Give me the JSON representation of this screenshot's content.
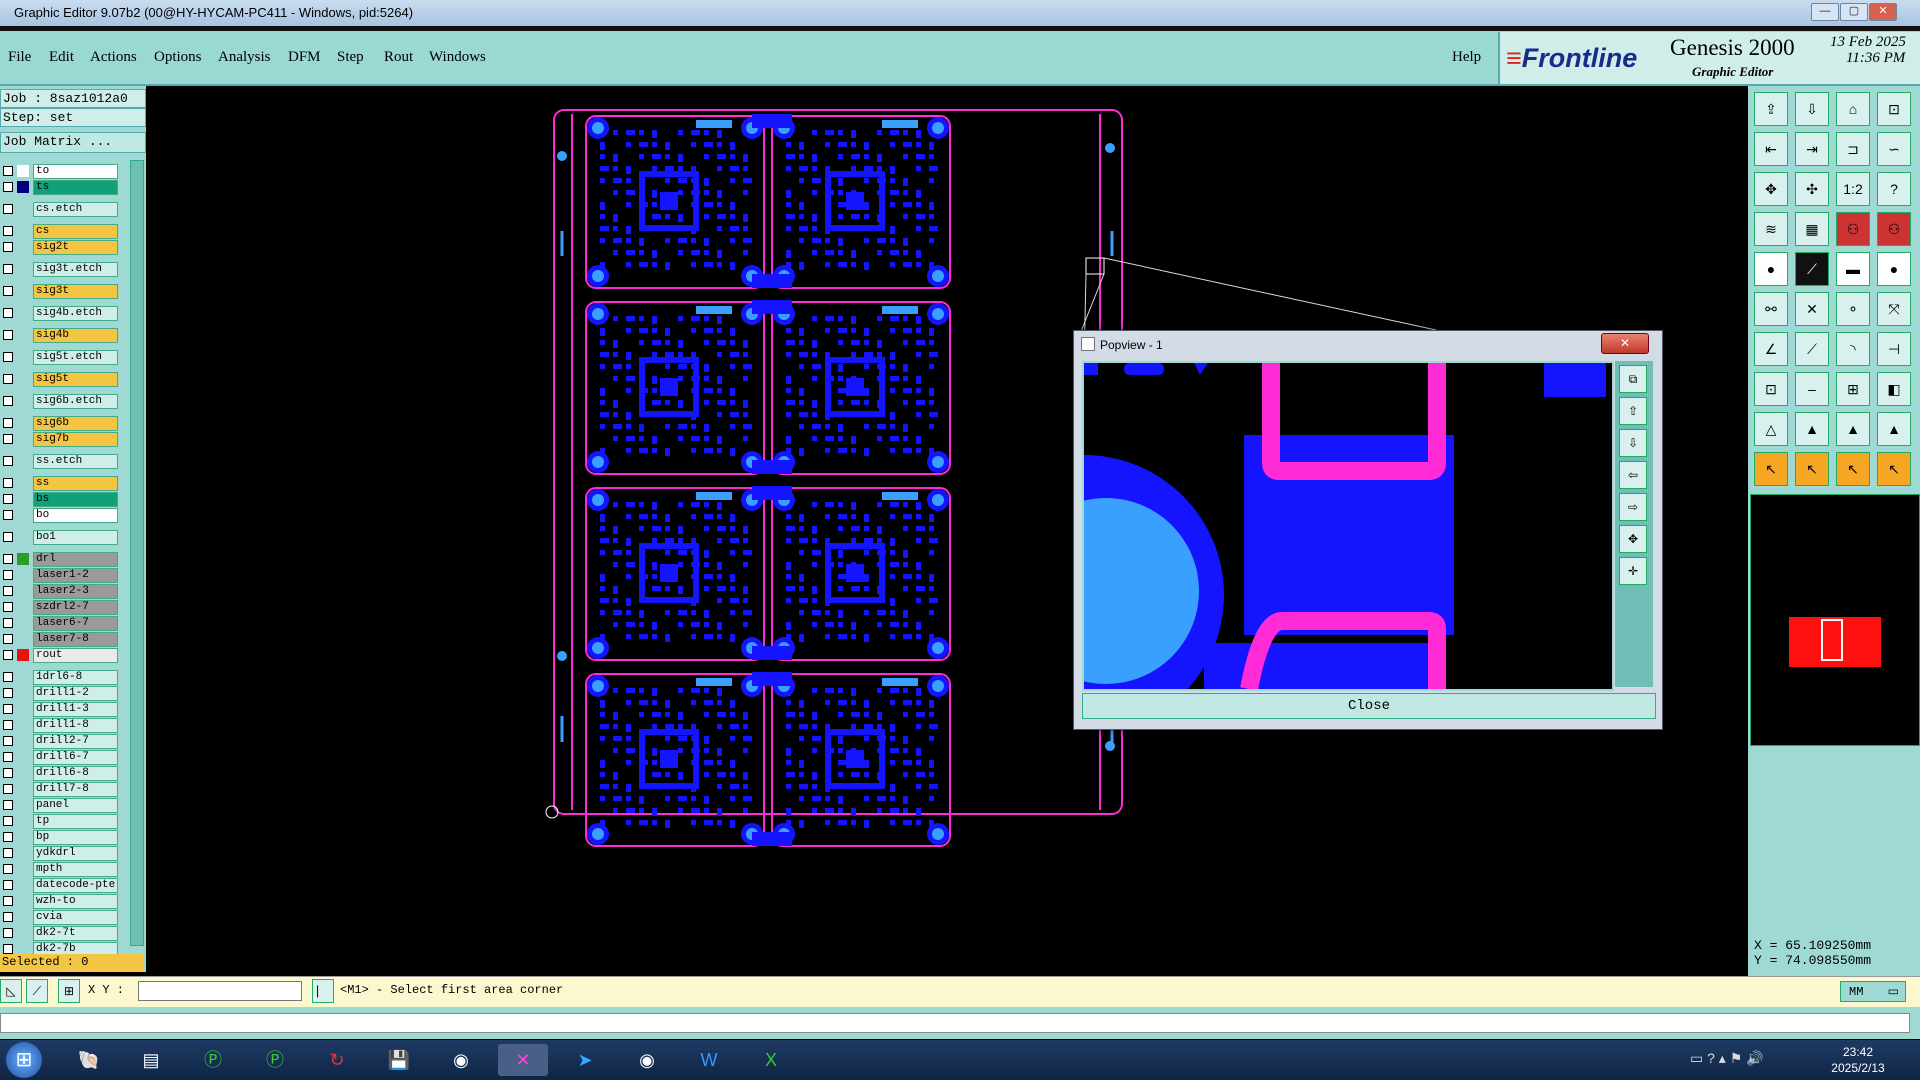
{
  "window": {
    "title": "Graphic Editor 9.07b2 (00@HY-HYCAM-PC411 - Windows, pid:5264)",
    "min": "—",
    "max": "▢",
    "close": "✕"
  },
  "menu": {
    "items": [
      "File",
      "Edit",
      "Actions",
      "Options",
      "Analysis",
      "DFM",
      "Step",
      "Rout",
      "Windows"
    ],
    "help": "Help"
  },
  "brand": {
    "logo": "Frontline",
    "product": "Genesis 2000",
    "subtitle": "Graphic Editor",
    "date": "13 Feb 2025",
    "time": "11:36 PM"
  },
  "job": {
    "job_line": "Job : 8saz1012a0",
    "step_line": "Step: set",
    "matrix_button": "Job Matrix ..."
  },
  "layers": [
    {
      "name": "to",
      "swatch": "#ffffff",
      "bg": "#ffffff"
    },
    {
      "name": "ts",
      "swatch": "#000080",
      "bg": "#12a07a"
    },
    {
      "name": "cs.etch",
      "swatch": "",
      "bg": "#cfeeea"
    },
    {
      "name": "cs",
      "swatch": "",
      "bg": "#f4c542"
    },
    {
      "name": "sig2t",
      "swatch": "",
      "bg": "#f4c542"
    },
    {
      "name": "sig3t.etch",
      "swatch": "",
      "bg": "#cfeeea"
    },
    {
      "name": "sig3t",
      "swatch": "",
      "bg": "#f4c542"
    },
    {
      "name": "sig4b.etch",
      "swatch": "",
      "bg": "#cfeeea"
    },
    {
      "name": "sig4b",
      "swatch": "",
      "bg": "#f4c542"
    },
    {
      "name": "sig5t.etch",
      "swatch": "",
      "bg": "#cfeeea"
    },
    {
      "name": "sig5t",
      "swatch": "",
      "bg": "#f4c542"
    },
    {
      "name": "sig6b.etch",
      "swatch": "",
      "bg": "#cfeeea"
    },
    {
      "name": "sig6b",
      "swatch": "",
      "bg": "#f4c542"
    },
    {
      "name": "sig7b",
      "swatch": "",
      "bg": "#f4c542"
    },
    {
      "name": "ss.etch",
      "swatch": "",
      "bg": "#cfeeea"
    },
    {
      "name": "ss",
      "swatch": "",
      "bg": "#f4c542"
    },
    {
      "name": "bs",
      "swatch": "",
      "bg": "#12a07a"
    },
    {
      "name": "bo",
      "swatch": "",
      "bg": "#ffffff"
    },
    {
      "name": "bo1",
      "swatch": "",
      "bg": "#cfeeea"
    },
    {
      "name": "drl",
      "swatch": "#2a9d2a",
      "bg": "#9a9a9a"
    },
    {
      "name": "laser1-2",
      "swatch": "",
      "bg": "#9a9a9a"
    },
    {
      "name": "laser2-3",
      "swatch": "",
      "bg": "#9a9a9a"
    },
    {
      "name": "szdrl2-7",
      "swatch": "",
      "bg": "#9a9a9a"
    },
    {
      "name": "laser6-7",
      "swatch": "",
      "bg": "#9a9a9a"
    },
    {
      "name": "laser7-8",
      "swatch": "",
      "bg": "#9a9a9a"
    },
    {
      "name": "rout",
      "swatch": "#e11",
      "bg": "#eaeaea"
    },
    {
      "name": "1drl6-8",
      "swatch": "",
      "bg": "#cfeeea"
    },
    {
      "name": "drill1-2",
      "swatch": "",
      "bg": "#cfeeea"
    },
    {
      "name": "drill1-3",
      "swatch": "",
      "bg": "#cfeeea"
    },
    {
      "name": "drill1-8",
      "swatch": "",
      "bg": "#cfeeea"
    },
    {
      "name": "drill2-7",
      "swatch": "",
      "bg": "#cfeeea"
    },
    {
      "name": "drill6-7",
      "swatch": "",
      "bg": "#cfeeea"
    },
    {
      "name": "drill6-8",
      "swatch": "",
      "bg": "#cfeeea"
    },
    {
      "name": "drill7-8",
      "swatch": "",
      "bg": "#cfeeea"
    },
    {
      "name": "panel",
      "swatch": "",
      "bg": "#cfeeea"
    },
    {
      "name": "tp",
      "swatch": "",
      "bg": "#cfeeea"
    },
    {
      "name": "bp",
      "swatch": "",
      "bg": "#cfeeea"
    },
    {
      "name": "ydkdrl",
      "swatch": "",
      "bg": "#cfeeea"
    },
    {
      "name": "mpth",
      "swatch": "",
      "bg": "#cfeeea"
    },
    {
      "name": "datecode-pte",
      "swatch": "",
      "bg": "#cfeeea"
    },
    {
      "name": "wzh-to",
      "swatch": "",
      "bg": "#cfeeea"
    },
    {
      "name": "cvia",
      "swatch": "",
      "bg": "#cfeeea"
    },
    {
      "name": "dk2-7t",
      "swatch": "",
      "bg": "#cfeeea"
    },
    {
      "name": "dk2-7b",
      "swatch": "",
      "bg": "#cfeeea"
    }
  ],
  "selected_text": "Selected : 0",
  "popview": {
    "title": "Popview - 1",
    "close_x": "✕",
    "close_button": "Close"
  },
  "coords": {
    "x_line": "X = 65.109250mm",
    "y_line": "Y = 74.098550mm"
  },
  "status": {
    "xy_label": "X Y :",
    "xy_value": "",
    "prompt": "<M1> - Select first area corner",
    "unit": "MM"
  },
  "taskbar": {
    "time": "23:42",
    "date": "2025/2/13",
    "start": "⊞"
  },
  "colors": {
    "panel": "#9ed9d3",
    "outline": "#ff2bd6",
    "copper": "#1414ff",
    "pad": "#3aa0ff"
  }
}
